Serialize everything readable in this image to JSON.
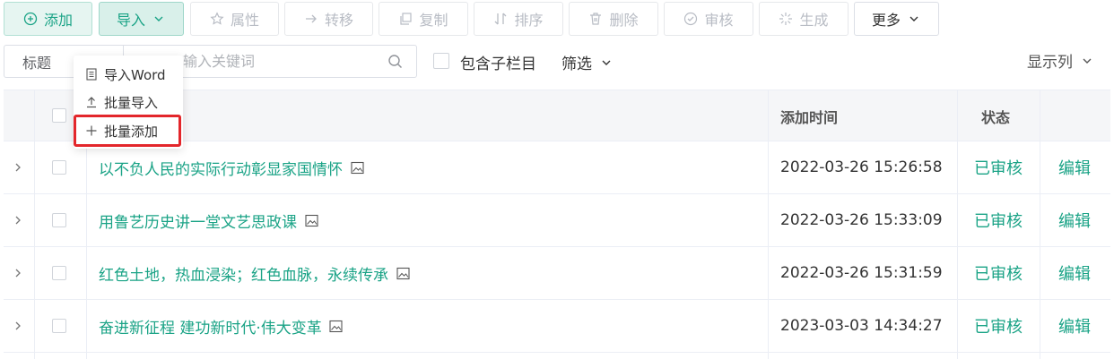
{
  "toolbar": {
    "add": "添加",
    "import": "导入",
    "attributes": "属性",
    "transfer": "转移",
    "copy": "复制",
    "sort": "排序",
    "delete": "删除",
    "review": "审核",
    "generate": "生成",
    "more": "更多"
  },
  "filter": {
    "field_select": "标题",
    "search_placeholder": "输入关键词",
    "include_sub": "包含子栏目",
    "filter_label": "筛选",
    "columns_label": "显示列"
  },
  "import_menu": {
    "items": [
      "导入Word",
      "批量导入",
      "批量添加"
    ]
  },
  "table": {
    "headers": {
      "time": "添加时间",
      "status": "状态"
    },
    "rows": [
      {
        "title": "以不负人民的实际行动彰显家国情怀",
        "time": "2022-03-26 15:26:58",
        "status": "已审核",
        "action": "编辑"
      },
      {
        "title": "用鲁艺历史讲一堂文艺思政课",
        "time": "2022-03-26 15:33:09",
        "status": "已审核",
        "action": "编辑"
      },
      {
        "title": "红色土地，热血浸染；红色血脉，永续传承",
        "time": "2022-03-26 15:31:59",
        "status": "已审核",
        "action": "编辑"
      },
      {
        "title": "奋进新征程 建功新时代·伟大变革",
        "time": "2023-03-03 14:34:27",
        "status": "已审核",
        "action": "编辑"
      }
    ]
  },
  "colors": {
    "accent": "#1aa386",
    "highlight": "#e3262b"
  },
  "icons": {
    "add": "plus-circle-icon",
    "import": "chevron-down-icon",
    "attributes": "star-icon",
    "transfer": "arrow-right-icon",
    "copy": "copy-icon",
    "sort": "sort-icon",
    "delete": "trash-icon",
    "review": "check-circle-icon",
    "generate": "sparkle-icon",
    "more": "chevron-down-icon",
    "row_image": "image-icon",
    "expand": "chevron-right-icon",
    "search": "search-icon"
  }
}
